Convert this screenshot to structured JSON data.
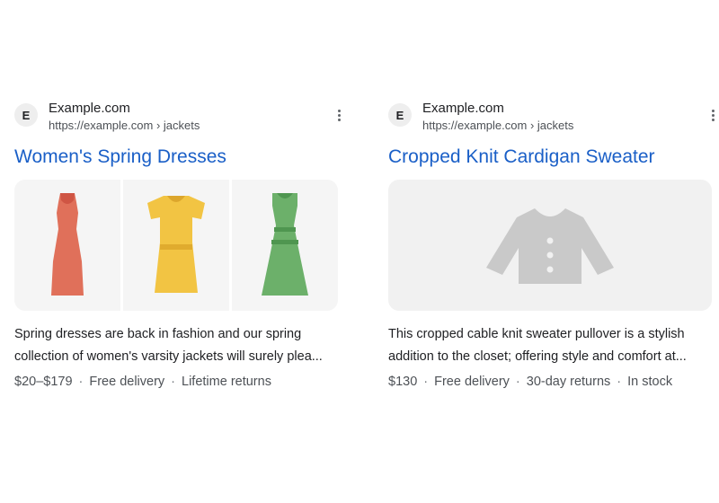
{
  "results": [
    {
      "favicon_letter": "E",
      "site_name": "Example.com",
      "url": "https://example.com",
      "breadcrumb": "› jackets",
      "title": "Women's Spring Dresses",
      "images": [
        {
          "icon": "red-dress-icon",
          "color": "#e0705a"
        },
        {
          "icon": "yellow-dress-icon",
          "color": "#f2c443"
        },
        {
          "icon": "green-dress-icon",
          "color": "#6cb06a"
        }
      ],
      "snippet_line1": "Spring dresses are back in fashion and our spring",
      "snippet_line2": "collection of women's varsity jackets will surely plea...",
      "meta": [
        "$20–$179",
        "Free delivery",
        "Lifetime returns"
      ]
    },
    {
      "favicon_letter": "E",
      "site_name": "Example.com",
      "url": "https://example.com",
      "breadcrumb": "› jackets",
      "title": "Cropped Knit Cardigan Sweater",
      "images": [
        {
          "icon": "cardigan-sweater-icon",
          "color": "#c9c9c9"
        }
      ],
      "snippet_line1": "This cropped cable knit sweater pullover is a stylish",
      "snippet_line2": "addition to the closet; offering style and comfort at...",
      "meta": [
        "$130",
        "Free delivery",
        "30-day returns",
        "In stock"
      ]
    }
  ],
  "separator": "·"
}
